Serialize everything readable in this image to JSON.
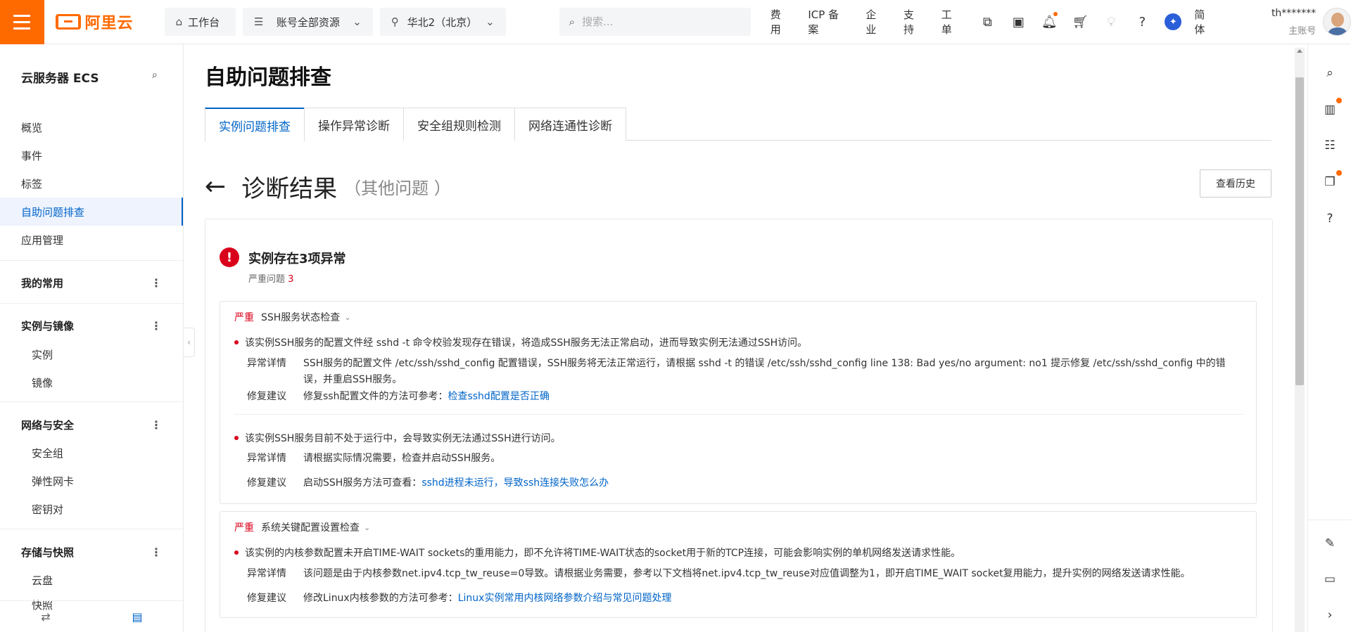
{
  "topbar": {
    "logo_text": "阿里云",
    "workbench": "工作台",
    "resources": "账号全部资源",
    "region": "华北2（北京）",
    "search_placeholder": "搜索...",
    "links": [
      "费用",
      "ICP 备案",
      "企业",
      "支持",
      "工单"
    ],
    "lang": "简体",
    "account_name": "th*******",
    "account_sub": "主账号",
    "accent_color": "#ff6a00"
  },
  "sidebar": {
    "title": "云服务器 ECS",
    "items": [
      "概览",
      "事件",
      "标签",
      "自助问题排查",
      "应用管理"
    ],
    "group_favorites": "我的常用",
    "group_instances": "实例与镜像",
    "instances_items": [
      "实例",
      "镜像"
    ],
    "group_network": "网络与安全",
    "network_items": [
      "安全组",
      "弹性网卡",
      "密钥对"
    ],
    "group_storage": "存储与快照",
    "storage_items": [
      "云盘",
      "快照"
    ]
  },
  "main": {
    "title": "自助问题排查",
    "tabs": [
      "实例问题排查",
      "操作异常诊断",
      "安全组规则检测",
      "网络连通性诊断"
    ],
    "result_title": "诊断结果",
    "result_sub": "（其他问题 ）",
    "history_button": "查看历史",
    "summary_title": "实例存在3项异常",
    "summary_label": "严重问题",
    "summary_count": "3",
    "issues": [
      {
        "severity": "严重",
        "name": "SSH服务状态检查",
        "items": [
          {
            "desc": "该实例SSH服务的配置文件经 sshd -t 命令校验发现存在错误，将造成SSH服务无法正常启动，进而导致实例无法通过SSH访问。",
            "detail_label": "异常详情",
            "detail": "SSH服务的配置文件 /etc/ssh/sshd_config 配置错误，SSH服务将无法正常运行，请根据 sshd -t 的错误 /etc/ssh/sshd_config line 138: Bad yes/no argument: no1 提示修复 /etc/ssh/sshd_config 中的错误，并重启SSH服务。",
            "fix_label": "修复建议",
            "fix_text": "修复ssh配置文件的方法可参考：",
            "fix_link": "检查sshd配置是否正确"
          },
          {
            "desc": "该实例SSH服务目前不处于运行中，会导致实例无法通过SSH进行访问。",
            "detail_label": "异常详情",
            "detail": "请根据实际情况需要，检查并启动SSH服务。",
            "fix_label": "修复建议",
            "fix_text": "启动SSH服务方法可查看：",
            "fix_link": "sshd进程未运行，导致ssh连接失败怎么办"
          }
        ]
      },
      {
        "severity": "严重",
        "name": "系统关键配置设置检查",
        "items": [
          {
            "desc": "该实例的内核参数配置未开启TIME-WAIT sockets的重用能力，即不允许将TIME-WAIT状态的socket用于新的TCP连接，可能会影响实例的单机网络发送请求性能。",
            "detail_label": "异常详情",
            "detail": "该问题是由于内核参数net.ipv4.tcp_tw_reuse=0导致。请根据业务需要，参考以下文档将net.ipv4.tcp_tw_reuse对应值调整为1，即开启TIME_WAIT socket复用能力，提升实例的网络发送请求性能。",
            "fix_label": "修复建议",
            "fix_text": "修改Linux内核参数的方法可参考：",
            "fix_link": "Linux实例常用内核网络参数介绍与常见问题处理"
          }
        ]
      }
    ],
    "severe_color": "#d9001b",
    "link_color": "#0064c8"
  }
}
